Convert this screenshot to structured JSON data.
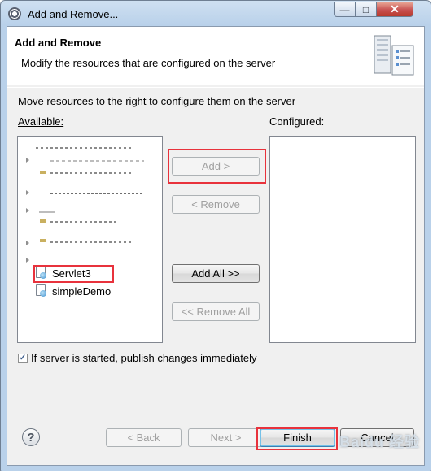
{
  "window": {
    "title": "Add and Remove..."
  },
  "banner": {
    "title": "Add and Remove",
    "description": "Modify the resources that are configured on the server",
    "icon": "server-wizard-icon"
  },
  "instructions": "Move resources to the right to configure them on the server",
  "available": {
    "label": "Available:",
    "items": [
      {
        "label": "Servlet3",
        "icon": "web-project-icon"
      },
      {
        "label": "simpleDemo",
        "icon": "web-project-icon"
      }
    ]
  },
  "configured": {
    "label": "Configured:",
    "items": []
  },
  "buttons": {
    "add": "Add >",
    "remove": "< Remove",
    "add_all": "Add All >>",
    "remove_all": "<< Remove All",
    "back": "< Back",
    "next": "Next >",
    "finish": "Finish",
    "cancel": "Cancel"
  },
  "publish_option": {
    "label": "If server is started, publish changes immediately",
    "checked": true
  },
  "highlight_color": "#e8323c",
  "watermark": "Baidu 经验"
}
